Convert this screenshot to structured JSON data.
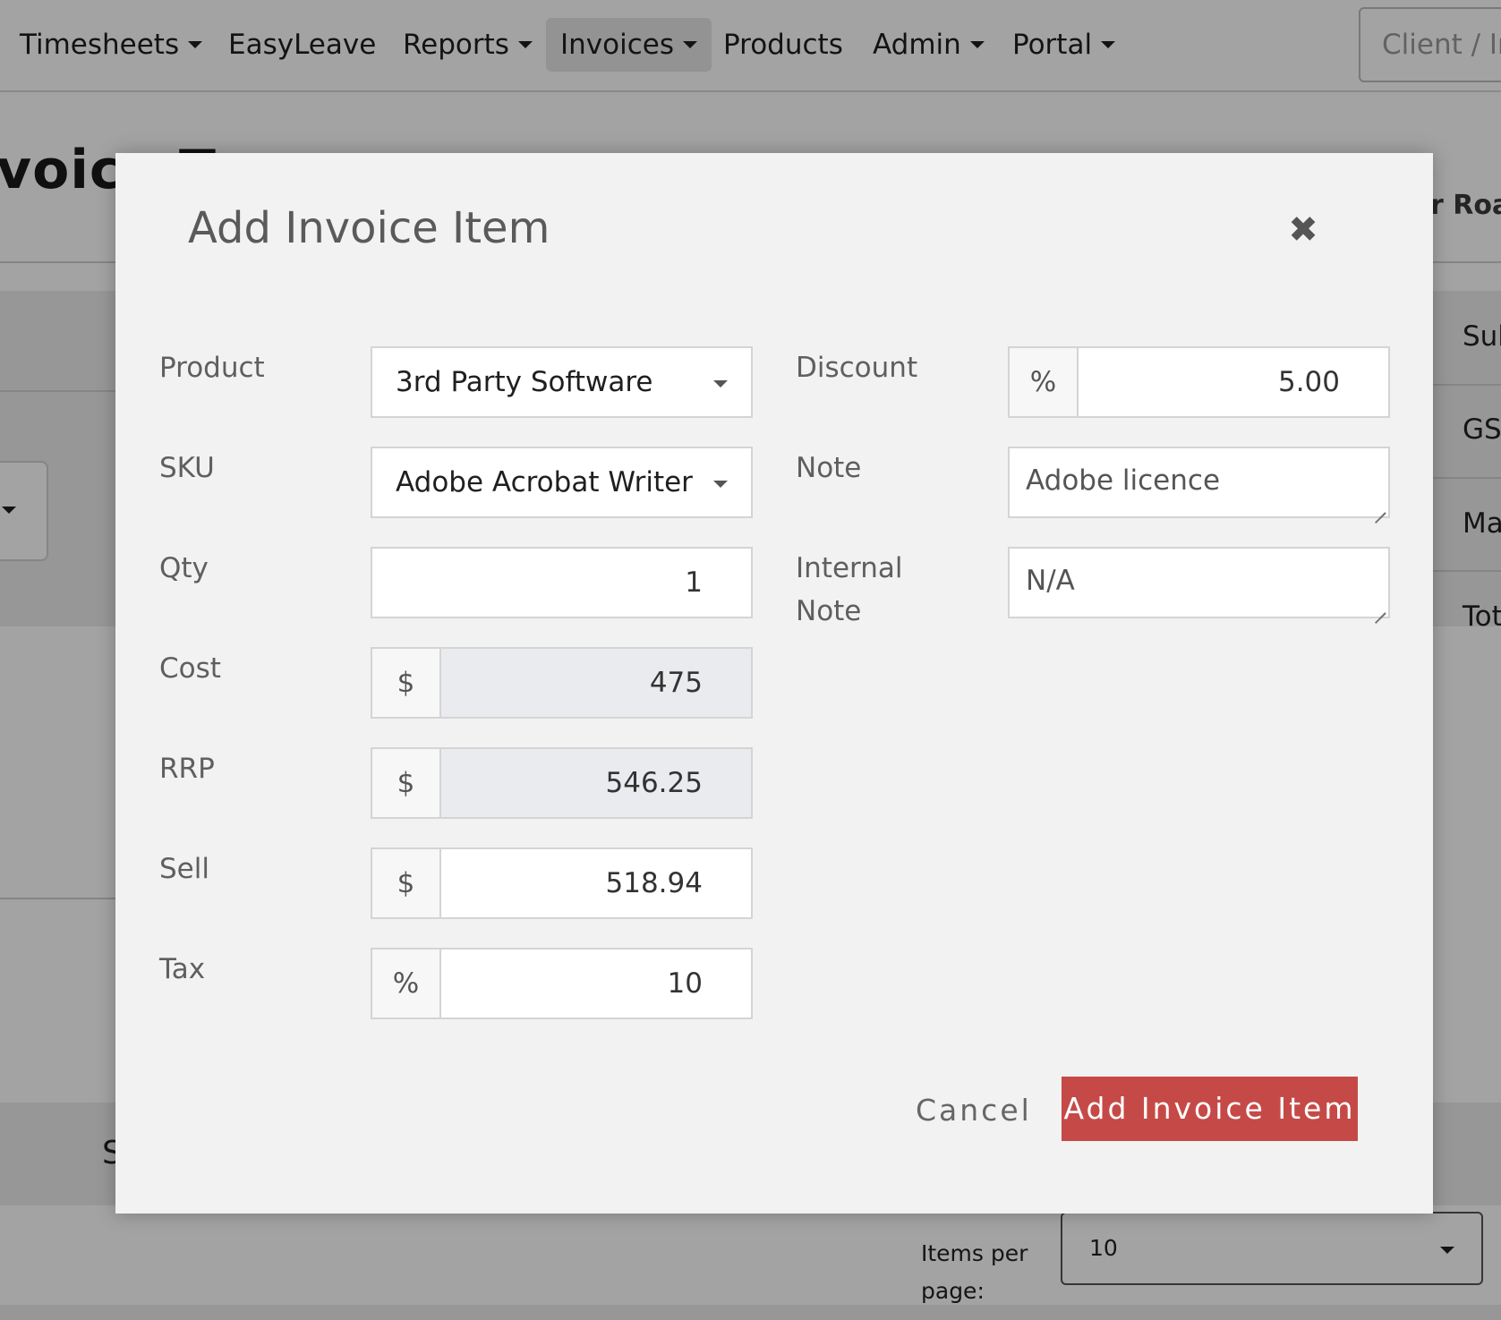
{
  "navbar": {
    "items": [
      {
        "label": "Timesheets",
        "dropdown": true
      },
      {
        "label": "EasyLeave",
        "dropdown": false
      },
      {
        "label": "Reports",
        "dropdown": true
      },
      {
        "label": "Invoices",
        "dropdown": true,
        "active": true
      },
      {
        "label": "Products",
        "dropdown": false
      },
      {
        "label": "Admin",
        "dropdown": true
      },
      {
        "label": "Portal",
        "dropdown": true
      }
    ],
    "client_search_placeholder": "Client / In"
  },
  "background": {
    "page_title": "voice T",
    "address_fragment": "r Roa",
    "summary_labels": [
      "Sub",
      "GS",
      "Ma",
      "Tot"
    ],
    "section_fragment": "S",
    "pager": {
      "label": "Items per page:",
      "selected": "10"
    }
  },
  "modal": {
    "title": "Add Invoice Item",
    "close_icon": "close-icon",
    "fields": {
      "product": {
        "label": "Product",
        "value": "3rd Party Software"
      },
      "sku": {
        "label": "SKU",
        "value": "Adobe Acrobat Writer"
      },
      "qty": {
        "label": "Qty",
        "value": "1"
      },
      "cost": {
        "label": "Cost",
        "prefix": "$",
        "value": "475"
      },
      "rrp": {
        "label": "RRP",
        "prefix": "$",
        "value": "546.25"
      },
      "sell": {
        "label": "Sell",
        "prefix": "$",
        "value": "518.94"
      },
      "tax": {
        "label": "Tax",
        "prefix": "%",
        "value": "10"
      },
      "discount": {
        "label": "Discount",
        "prefix": "%",
        "value": "5.00"
      },
      "note": {
        "label": "Note",
        "value": "Adobe licence"
      },
      "internal_note": {
        "label_line1": "Internal",
        "label_line2": "Note",
        "value": "N/A"
      }
    },
    "cancel_label": "Cancel",
    "submit_label": "Add Invoice Item"
  },
  "colors": {
    "primary_button": "#c54a47",
    "modal_background": "#f2f2f2",
    "backdrop": "rgba(0,0,0,0.36)",
    "readonly_input": "#e9ebee"
  }
}
